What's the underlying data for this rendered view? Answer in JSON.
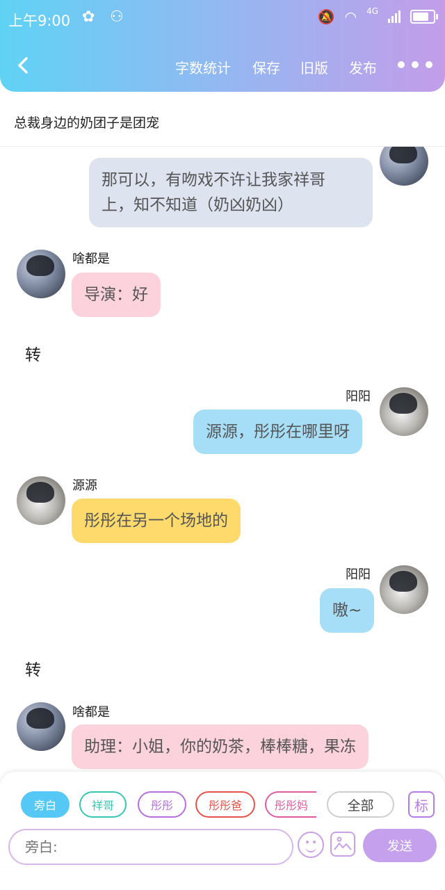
{
  "status_bar": {
    "time": "上午9:00",
    "network": "4G"
  },
  "toolbar": {
    "word_count": "字数统计",
    "save": "保存",
    "old_version": "旧版",
    "publish": "发布"
  },
  "story_title": "总裁身边的奶团子是团宠",
  "messages": [
    {
      "speaker": "",
      "side": "right",
      "text_lines": [
        "那可以，有吻戏不许让我家祥哥",
        "上，知不知道（奶凶奶凶）"
      ],
      "color": "#dde3ef"
    },
    {
      "speaker": "啥都是",
      "side": "left",
      "text": "导演：好",
      "color": "#fcd3dd"
    },
    {
      "narration": "转"
    },
    {
      "speaker": "阳阳",
      "side": "right",
      "text": "源源，彤彤在哪里呀",
      "color": "#a6def7"
    },
    {
      "speaker": "源源",
      "side": "left",
      "text": "彤彤在另一个场地的",
      "color": "#fdda6b"
    },
    {
      "speaker": "阳阳",
      "side": "right",
      "text": "嗷~",
      "color": "#a6def7"
    },
    {
      "narration": "转"
    },
    {
      "speaker": "啥都是",
      "side": "left",
      "text": "助理：小姐，你的奶茶，棒棒糖，果冻",
      "color": "#fcd3dd"
    }
  ],
  "chips": [
    "旁白",
    "祥哥",
    "彤彤",
    "彤彤爸",
    "彤彤妈",
    "全部",
    "标"
  ],
  "input": {
    "placeholder": "旁白:"
  },
  "send_label": "发送",
  "colors": {
    "header_start": "#5fd2f4",
    "header_end": "#c39de9",
    "accent": "#c5a0ec"
  }
}
